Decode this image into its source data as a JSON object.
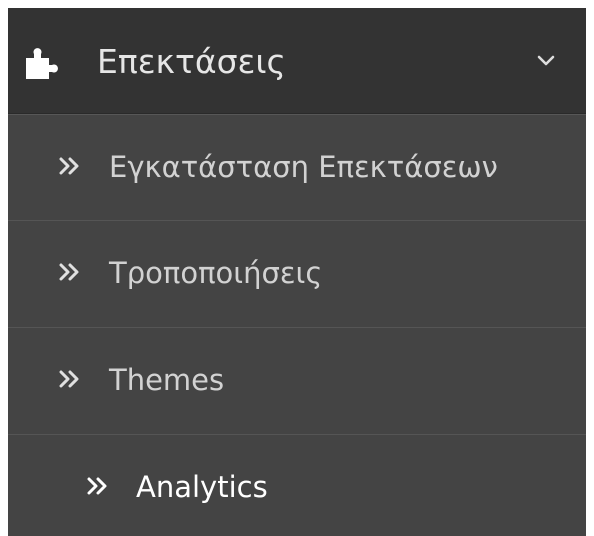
{
  "menu": {
    "header": {
      "label": "Επεκτάσεις",
      "icon": "puzzle-icon",
      "toggle_icon": "chevron-down-icon"
    },
    "items": [
      {
        "label": "Εγκατάσταση Επεκτάσεων",
        "icon": "double-chevron-right-icon"
      },
      {
        "label": "Τροποποιήσεις",
        "icon": "double-chevron-right-icon"
      },
      {
        "label": "Themes",
        "icon": "double-chevron-right-icon"
      },
      {
        "label": "Analytics",
        "icon": "double-chevron-right-icon",
        "active": true
      }
    ]
  },
  "colors": {
    "header_background": "#333333",
    "menu_background": "#444444",
    "text": "#d2d2d2",
    "active_text": "#ffffff"
  }
}
